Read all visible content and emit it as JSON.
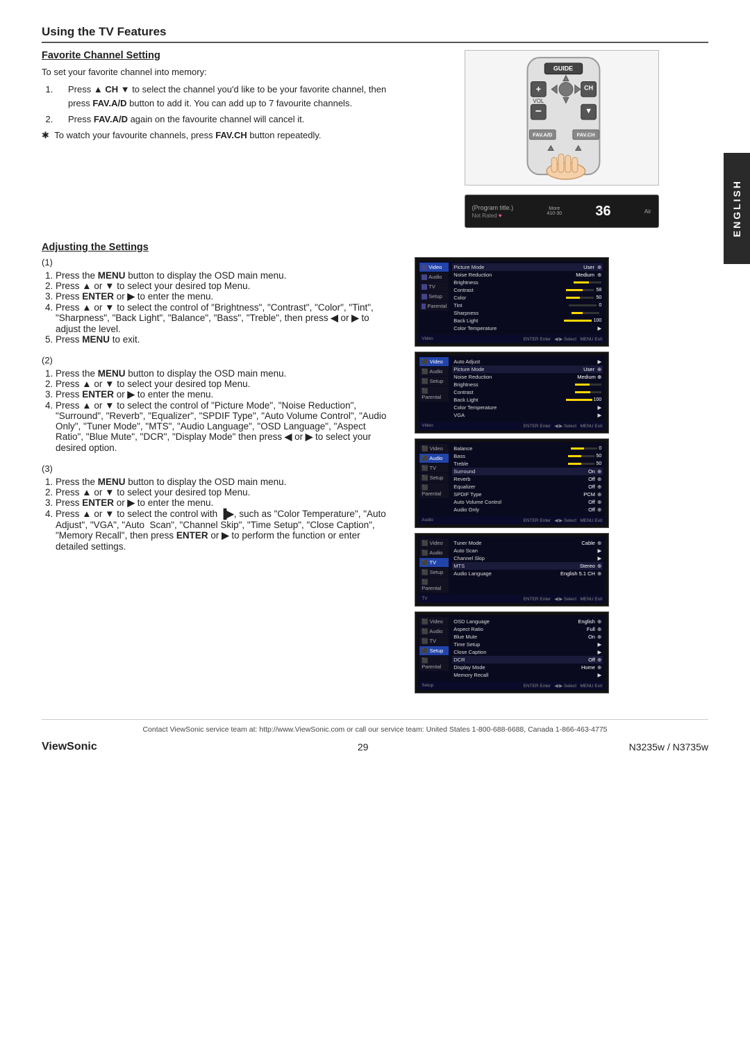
{
  "page": {
    "title": "Using the TV Features",
    "side_tab": "ENGLISH"
  },
  "favorite_channel": {
    "heading": "Favorite Channel Setting",
    "intro": "To set your favorite channel into memory:",
    "steps": [
      "Press ▲ CH ▼ to select the channel you'd like to be your favorite channel, then press FAV.A/D button to add it. You can add up to 7 favourite channels.",
      "Press FAV.A/D again on the favourite channel will cancel it."
    ],
    "note": "To watch your favourite channels, press FAV.CH button repeatedly."
  },
  "tv_screen": {
    "left_label": "(Program title.)",
    "menu_label": "More",
    "channel_label": "410-30",
    "rating": "Not Rated",
    "channel_num": "36",
    "source": "Air"
  },
  "adjusting": {
    "heading": "Adjusting the Settings",
    "section1": {
      "num": "(1)",
      "steps": [
        "Press the MENU button to display the OSD main menu.",
        "Press ▲ or ▼ to select your desired top Menu.",
        "Press ENTER or ▶ to enter the menu.",
        "Press ▲ or ▼ to select the control of \"Brightness\", \"Contrast\", \"Color\", \"Tint\", \"Sharpness\", \"Back Light\", \"Balance\", \"Bass\", \"Treble\", then press ◀ or ▶ to adjust the level.",
        "Press MENU to exit."
      ]
    },
    "section2": {
      "num": "(2)",
      "steps": [
        "Press the MENU button to display the OSD main menu.",
        "Press ▲ or ▼ to select your desired top Menu.",
        "Press ENTER or ▶ to enter the menu.",
        "Press ▲ or ▼ to select the control of \"Picture Mode\", \"Noise Reduction\", \"Surround\", \"Reverb\", \"Equalizer\", \"SPDIF Type\", \"Auto Volume Control\", \"Audio Only\", \"Tuner Mode\", \"MTS\", \"Audio Language\", \"OSD Language\", \"Aspect Ratio\", \"Blue Mute\", \"DCR\", \"Display Mode\" then press ◀ or ▶ to select your desired option."
      ]
    },
    "section3": {
      "num": "(3)",
      "steps": [
        "Press the MENU button to display the OSD main menu.",
        "Press ▲ or ▼ to select your desired top Menu.",
        "Press ENTER or ▶ to enter the menu.",
        "Press ▲ or ▼ to select the control with ▐▶, such as \"Color Temperature\", \"Auto Adjust\", \"VGA\", \"Auto Scan\", \"Channel Skip\", \"Time Setup\", \"Close Caption\", \"Memory Recall\", then press ENTER or ▶ to perform the function or enter detailed settings."
      ]
    }
  },
  "osd_panels": [
    {
      "id": "video1",
      "title_left": "Video",
      "title_right": "ENTER Enter  ◀/▶ Select  MENU Exit",
      "sidebar_items": [
        "Video",
        "Audio",
        "TV",
        "Setup",
        "Parental"
      ],
      "active_item": 0,
      "rows": [
        {
          "label": "Picture Mode",
          "value": "User",
          "has_arrow": true
        },
        {
          "label": "Noise Reduction",
          "value": "Medium",
          "has_arrow": true
        },
        {
          "label": "Brightness",
          "bar": 55,
          "value": ""
        },
        {
          "label": "Contrast",
          "bar": 58,
          "value": ""
        },
        {
          "label": "Color",
          "bar": 50,
          "value": ""
        },
        {
          "label": "Tint",
          "bar": 0,
          "value": "0"
        },
        {
          "label": "Sharpness",
          "bar": 40,
          "value": ""
        },
        {
          "label": "Back Light",
          "bar": 100,
          "value": "100"
        },
        {
          "label": "Color Temperature",
          "value": "",
          "has_arrow": true
        }
      ]
    },
    {
      "id": "video2",
      "title_left": "Video",
      "title_right": "ENTER Enter  ◀/▶ Select  MENU Exit",
      "sidebar_items": [
        "Video",
        "Audio",
        "Setup",
        "Parental"
      ],
      "active_item": 0,
      "rows": [
        {
          "label": "Auto Adjust",
          "value": "",
          "has_arrow": true
        },
        {
          "label": "Picture Mode",
          "value": "User",
          "has_arrow": true
        },
        {
          "label": "Noise Reduction",
          "value": "Medium",
          "has_arrow": true
        },
        {
          "label": "Brightness",
          "bar": 55,
          "value": ""
        },
        {
          "label": "Contrast",
          "bar": 58,
          "value": ""
        },
        {
          "label": "Back Light",
          "bar": 100,
          "value": "100"
        },
        {
          "label": "Color Temperature",
          "value": "",
          "has_arrow": true
        },
        {
          "label": "VGA",
          "value": "",
          "has_arrow": true
        }
      ]
    },
    {
      "id": "audio",
      "title_left": "Audio",
      "title_right": "ENTER Enter  ◀/▶ Select  MENU Exit",
      "sidebar_items": [
        "Video",
        "Audio",
        "TV",
        "Setup",
        "Parental"
      ],
      "active_item": 1,
      "rows": [
        {
          "label": "Balance",
          "bar": 50,
          "value": "0"
        },
        {
          "label": "Bass",
          "bar": 50,
          "value": "50"
        },
        {
          "label": "Treble",
          "bar": 50,
          "value": "50"
        },
        {
          "label": "Surround",
          "value": "On",
          "has_arrow": true
        },
        {
          "label": "Reverb",
          "value": "Off",
          "has_arrow": true
        },
        {
          "label": "Equalizer",
          "value": "Off",
          "has_arrow": true
        },
        {
          "label": "SPDIF Type",
          "value": "PCM",
          "has_arrow": true
        },
        {
          "label": "Auto Volume Control",
          "value": "Off",
          "has_arrow": true
        },
        {
          "label": "Audio Only",
          "value": "Off",
          "has_arrow": true
        }
      ]
    },
    {
      "id": "tv",
      "title_left": "TV",
      "title_right": "ENTER Enter  ◀/▶ Select  MENU Exit",
      "sidebar_items": [
        "Video",
        "Audio",
        "TV",
        "Setup",
        "Parental"
      ],
      "active_item": 2,
      "rows": [
        {
          "label": "Tuner Mode",
          "value": "Cable",
          "has_arrow": true
        },
        {
          "label": "Auto Scan",
          "value": "",
          "has_arrow": true
        },
        {
          "label": "Channel Skip",
          "value": "",
          "has_arrow": true
        },
        {
          "label": "MTS",
          "value": "Stereo",
          "has_arrow": true
        },
        {
          "label": "Audio Language",
          "value": "English 5.1 CH",
          "has_arrow": true
        }
      ]
    },
    {
      "id": "setup",
      "title_left": "Setup",
      "title_right": "ENTER Enter  ◀/▶ Select  MENU Exit",
      "sidebar_items": [
        "Video",
        "Audio",
        "TV",
        "Setup",
        "Parental"
      ],
      "active_item": 3,
      "rows": [
        {
          "label": "OSD Language",
          "value": "English",
          "has_arrow": true
        },
        {
          "label": "Aspect Ratio",
          "value": "Full",
          "has_arrow": true
        },
        {
          "label": "Blue Mute",
          "value": "On",
          "has_arrow": true
        },
        {
          "label": "Time Setup",
          "value": "",
          "has_arrow": true
        },
        {
          "label": "Close Caption",
          "value": "",
          "has_arrow": true
        },
        {
          "label": "DCR",
          "value": "Off",
          "has_arrow": true
        },
        {
          "label": "Display Mode",
          "value": "Home",
          "has_arrow": true
        },
        {
          "label": "Memory Recall",
          "value": "",
          "has_arrow": true
        }
      ]
    }
  ],
  "footer": {
    "contact": "Contact ViewSonic service team at: http://www.ViewSonic.com or call our service team: United States 1-800-688-6688, Canada 1-866-463-4775",
    "brand": "ViewSonic",
    "page_num": "29",
    "model": "N3235w / N3735w"
  }
}
